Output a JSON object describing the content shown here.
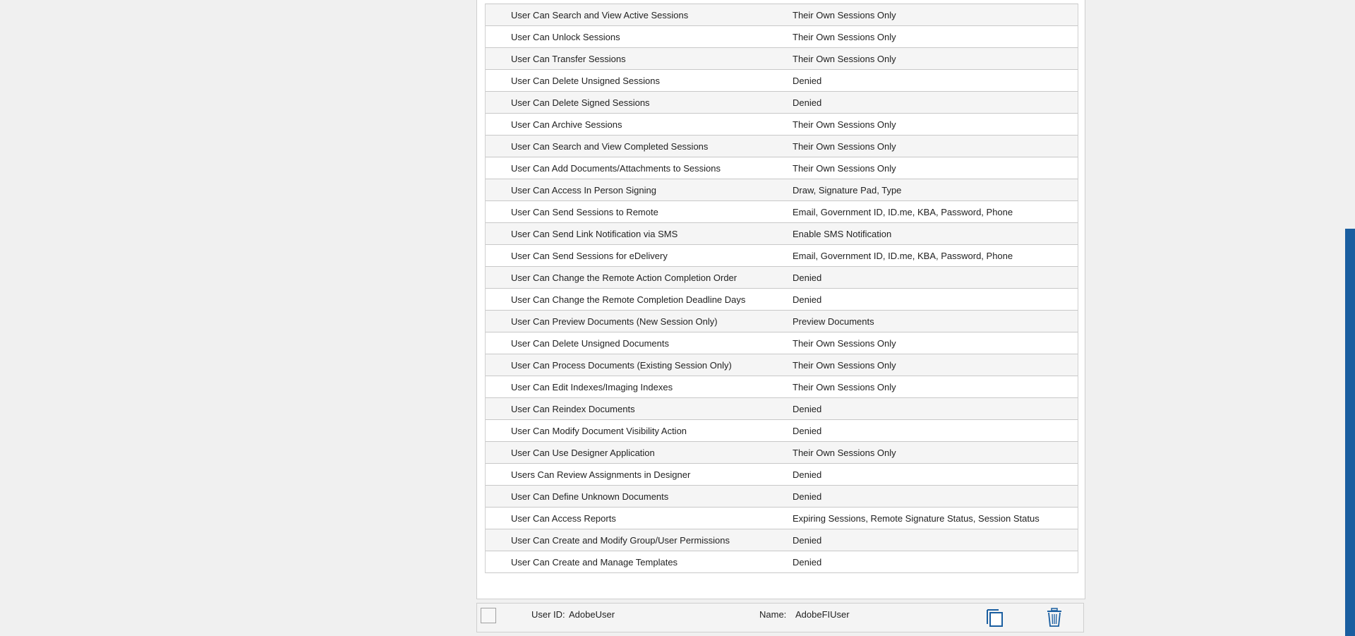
{
  "permissions": [
    {
      "name": "User Can Search and View Active Sessions",
      "value": "Their Own Sessions Only"
    },
    {
      "name": "User Can Unlock Sessions",
      "value": "Their Own Sessions Only"
    },
    {
      "name": "User Can Transfer Sessions",
      "value": "Their Own Sessions Only"
    },
    {
      "name": "User Can Delete Unsigned Sessions",
      "value": "Denied"
    },
    {
      "name": "User Can Delete Signed Sessions",
      "value": "Denied"
    },
    {
      "name": "User Can Archive Sessions",
      "value": "Their Own Sessions Only"
    },
    {
      "name": "User Can Search and View Completed Sessions",
      "value": "Their Own Sessions Only"
    },
    {
      "name": "User Can Add Documents/Attachments to Sessions",
      "value": "Their Own Sessions Only"
    },
    {
      "name": "User Can Access In Person Signing",
      "value": "Draw, Signature Pad, Type"
    },
    {
      "name": "User Can Send Sessions to Remote",
      "value": "Email, Government ID, ID.me, KBA, Password, Phone"
    },
    {
      "name": "User Can Send Link Notification via SMS",
      "value": "Enable SMS Notification"
    },
    {
      "name": "User Can Send Sessions for eDelivery",
      "value": "Email, Government ID, ID.me, KBA, Password, Phone"
    },
    {
      "name": "User Can Change the Remote Action Completion Order",
      "value": "Denied"
    },
    {
      "name": "User Can Change the Remote Completion Deadline Days",
      "value": "Denied"
    },
    {
      "name": "User Can Preview Documents (New Session Only)",
      "value": "Preview Documents"
    },
    {
      "name": "User Can Delete Unsigned Documents",
      "value": "Their Own Sessions Only"
    },
    {
      "name": "User Can Process Documents (Existing Session Only)",
      "value": "Their Own Sessions Only"
    },
    {
      "name": "User Can Edit Indexes/Imaging Indexes",
      "value": "Their Own Sessions Only"
    },
    {
      "name": "User Can Reindex Documents",
      "value": "Denied"
    },
    {
      "name": "User Can Modify Document Visibility Action",
      "value": "Denied"
    },
    {
      "name": "User Can Use Designer Application",
      "value": "Their Own Sessions Only"
    },
    {
      "name": "Users Can Review Assignments in Designer",
      "value": "Denied"
    },
    {
      "name": "User Can Define Unknown Documents",
      "value": "Denied"
    },
    {
      "name": "User Can Access Reports",
      "value": "Expiring Sessions, Remote Signature Status, Session Status"
    },
    {
      "name": "User Can Create and Modify Group/User Permissions",
      "value": "Denied"
    },
    {
      "name": "User Can Create and Manage Templates",
      "value": "Denied"
    }
  ],
  "user_bar": {
    "user_id_label": "User ID:",
    "user_id_value": "AdobeUser",
    "name_label": "Name:",
    "name_value": "AdobeFIUser",
    "copy_icon": "copy-icon",
    "delete_icon": "trash-icon"
  },
  "colors": {
    "accent": "#1a5ea0",
    "row_alt": "#f5f5f5",
    "background": "#f0f0f0"
  }
}
